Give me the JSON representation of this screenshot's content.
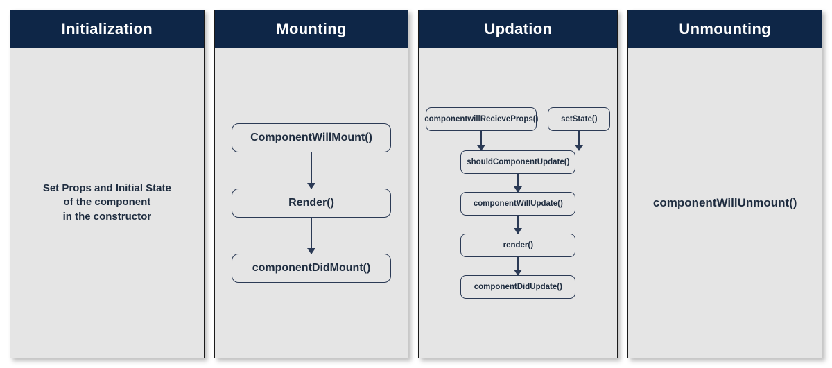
{
  "panels": {
    "initialization": {
      "title": "Initialization",
      "text_line1": "Set Props and Initial State",
      "text_line2": "of the component",
      "text_line3": "in the constructor"
    },
    "mounting": {
      "title": "Mounting",
      "nodes": {
        "n1": "ComponentWillMount()",
        "n2": "Render()",
        "n3": "componentDidMount()"
      }
    },
    "updation": {
      "title": "Updation",
      "top": {
        "left": "componentwillRecieveProps()",
        "right": "setState()"
      },
      "stack": {
        "s1": "shouldComponentUpdate()",
        "s2": "componentWillUpdate()",
        "s3": "render()",
        "s4": "componentDidUpdate()"
      }
    },
    "unmounting": {
      "title": "Unmounting",
      "text": "componentWillUnmount()"
    }
  },
  "colors": {
    "header_bg": "#0e2647",
    "panel_bg": "#e5e5e5",
    "border": "#2b3a55",
    "text": "#1e2c3f"
  }
}
